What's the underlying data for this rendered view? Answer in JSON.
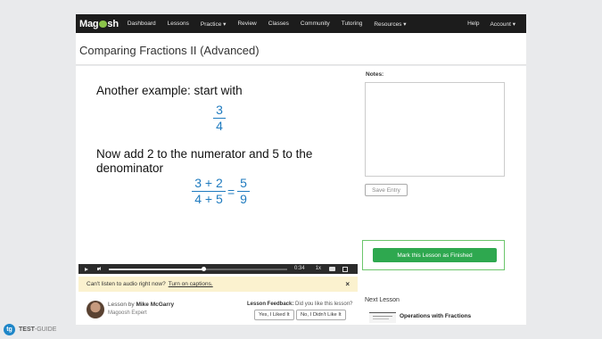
{
  "nav": {
    "logo_left": "Mag",
    "logo_right": "sh",
    "items": [
      "Dashboard",
      "Lessons",
      "Practice ▾",
      "Review",
      "Classes",
      "Community",
      "Tutoring",
      "Resources ▾"
    ],
    "help": "Help",
    "account": "Account ▾"
  },
  "page": {
    "title": "Comparing Fractions II (Advanced)"
  },
  "slide": {
    "line1": "Another example: start with",
    "frac1": {
      "num": "3",
      "den": "4"
    },
    "line2": "Now add 2 to the numerator and 5 to the denominator",
    "frac2": {
      "num": "3 + 2",
      "den": "4 + 5"
    },
    "equals": "=",
    "frac3": {
      "num": "5",
      "den": "9"
    }
  },
  "player": {
    "time": "0:34",
    "speed": "1x",
    "progress_fraction": 0.53
  },
  "caption_banner": {
    "text": "Can't listen to audio right now?",
    "link": "Turn on captions.",
    "close": "×"
  },
  "lesson": {
    "by_prefix": "Lesson by",
    "author": "Mike McGarry",
    "author_role": "Magoosh Expert"
  },
  "feedback": {
    "label": "Lesson Feedback:",
    "question": "Did you like this lesson?",
    "yes": "Yes, I Liked It",
    "no": "No, I Didn't Like It"
  },
  "sidebar": {
    "notes_label": "Notes:",
    "save_label": "Save Entry",
    "finish_label": "Mark this Lesson as Finished",
    "next_label": "Next Lesson",
    "next_title": "Operations with Fractions"
  },
  "watermark": {
    "brand": "TEST",
    "suffix": "-GUIDE"
  },
  "colors": {
    "accent_green": "#2ea84f",
    "fraction_blue": "#1f7bbf",
    "nav_bg": "#1c1c1c"
  }
}
